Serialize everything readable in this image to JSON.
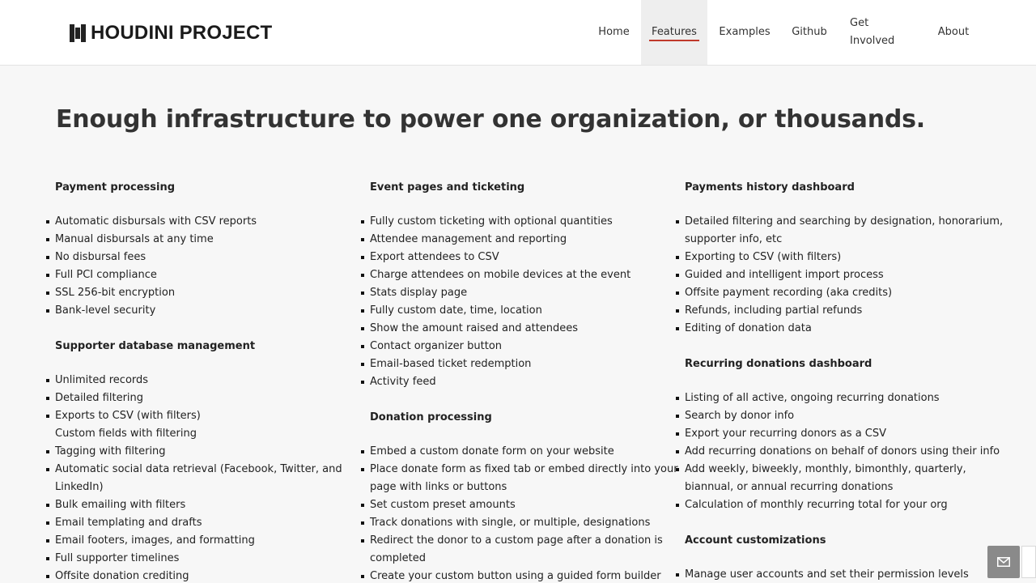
{
  "brand": {
    "name": "HOUDINI PROJECT",
    "logo_icon": "houdini-logo-icon"
  },
  "nav": [
    {
      "label": "Home",
      "active": false
    },
    {
      "label": "Features",
      "active": true
    },
    {
      "label": "Examples",
      "active": false
    },
    {
      "label": "Github",
      "active": false
    },
    {
      "label": "Get Involved",
      "active": false
    },
    {
      "label": "About",
      "active": false
    }
  ],
  "headline": "Enough infrastructure to power one organization, or thousands.",
  "columns": [
    {
      "sections": [
        {
          "title": "Payment processing",
          "items": [
            "Automatic disbursals with CSV reports",
            "Manual disbursals at any time",
            "No disbursal fees",
            "Full PCI compliance",
            "SSL 256-bit encryption",
            "Bank-level security"
          ]
        },
        {
          "title": "Supporter database management",
          "items": [
            "Unlimited records",
            "Detailed filtering",
            "Exports to CSV (with filters)",
            "Custom fields with filtering",
            "Tagging with filtering",
            "Automatic social data retrieval (Facebook, Twitter, and",
            "LinkedIn)",
            "Bulk emailing with filters",
            "Email templating and drafts",
            "Email footers, images, and formatting",
            "Full supporter timelines",
            "Offsite donation crediting"
          ]
        }
      ]
    },
    {
      "sections": [
        {
          "title": "Event pages and ticketing",
          "items": [
            "Fully custom ticketing with optional quantities",
            "Attendee management and reporting",
            "Export attendees to CSV",
            "Charge attendees on mobile devices at the event",
            "Stats display page",
            "Fully custom date, time, location",
            "Show the amount raised and attendees",
            "Contact organizer button",
            "Email-based ticket redemption",
            "Activity feed"
          ]
        },
        {
          "title": "Donation processing",
          "items": [
            "Embed a custom donate form on your website",
            "Place donate form as fixed tab or embed directly into your",
            "page with links or buttons",
            "Set custom preset amounts",
            "Track donations with single, or multiple, designations",
            "Redirect the donor to a custom page after a donation is",
            "completed",
            "Create your custom button using a guided form builder"
          ]
        }
      ]
    },
    {
      "sections": [
        {
          "title": "Payments history dashboard",
          "items": [
            "Detailed filtering and searching by designation, honorarium,",
            "supporter info, etc",
            "Exporting to CSV (with filters)",
            "Guided and intelligent import process",
            "Offsite payment recording (aka credits)",
            "Refunds, including partial refunds",
            "Editing of donation data"
          ]
        },
        {
          "title": "Recurring donations dashboard",
          "items": [
            "Listing of all active, ongoing recurring donations",
            "Search by donor info",
            "Export your recurring donors as a CSV",
            "Add recurring donations on behalf of donors using their info",
            "Add weekly, biweekly, monthly, bimonthly, quarterly,",
            "biannual, or annual recurring donations",
            "Calculation of monthly recurring total for your org"
          ]
        },
        {
          "title": "Account customizations",
          "items": [
            "Manage user accounts and set their permission levels"
          ]
        }
      ]
    }
  ],
  "support_button": {
    "icon": "mail-icon"
  }
}
